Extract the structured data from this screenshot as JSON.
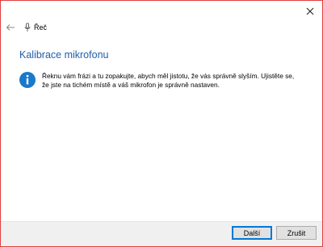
{
  "window": {
    "app_title": "Řeč",
    "close_icon": "close-icon",
    "back_icon": "back-arrow-icon",
    "mic_icon": "microphone-icon"
  },
  "main": {
    "heading": "Kalibrace mikrofonu",
    "info_icon": "info-icon",
    "info_text": "Řeknu vám frázi a tu zopakujte, abych měl jistotu, že vás správně slyším. Ujistěte se, že jste na tichém místě a váš mikrofon je správně nastaven."
  },
  "footer": {
    "next_label": "Další",
    "cancel_label": "Zrušit"
  },
  "colors": {
    "heading": "#1f5fa8",
    "info_icon": "#1979ca",
    "default_button_border": "#0078d7",
    "window_border": "#e04040"
  }
}
